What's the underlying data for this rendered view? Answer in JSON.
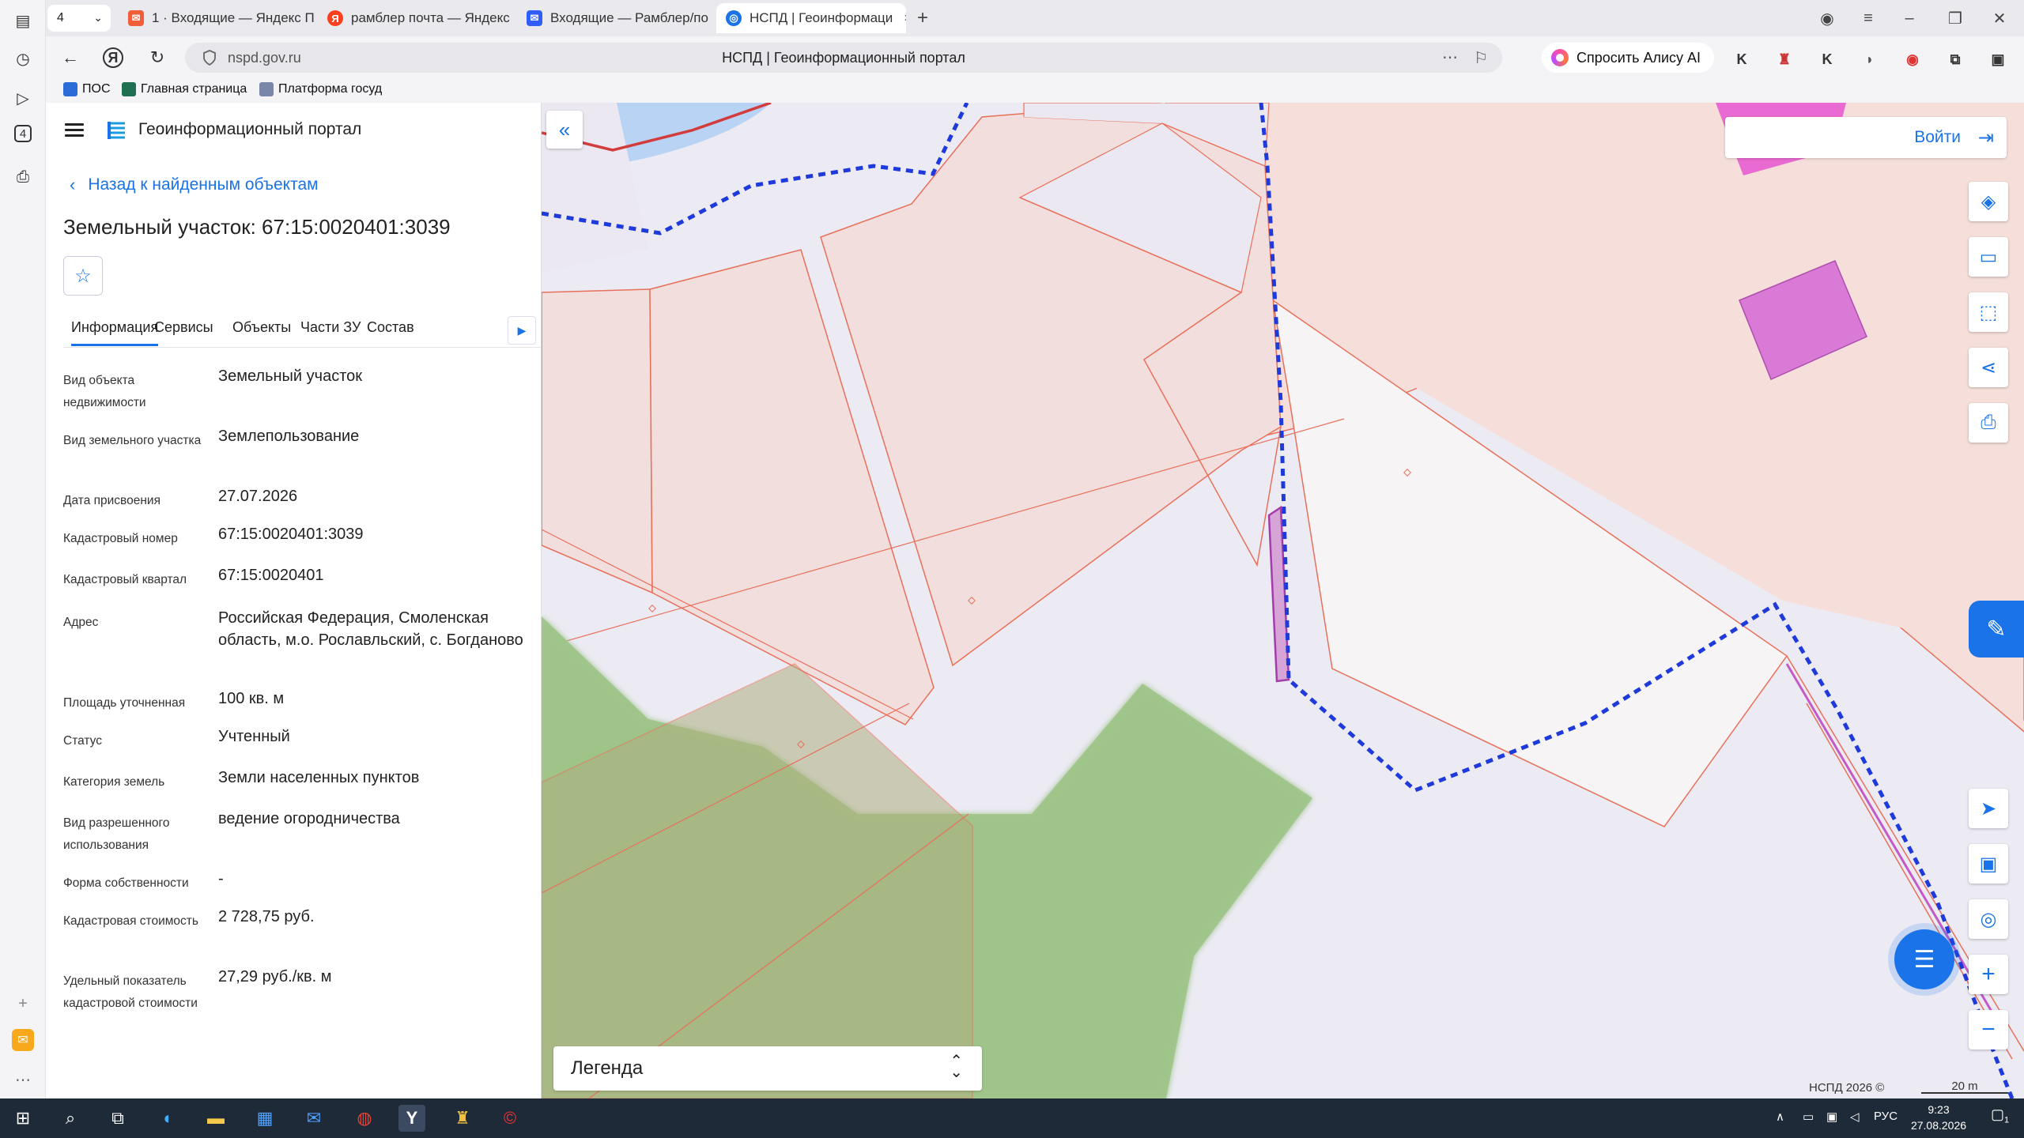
{
  "browser": {
    "tab_count": "4",
    "tabs": [
      {
        "label": "1 · Входящие — Яндекс П",
        "icon": "mail-icon",
        "color": "#f25d3a"
      },
      {
        "label": "рамблер почта — Яндекс",
        "icon": "yandex-search-icon",
        "color": "#fc3f1d"
      },
      {
        "label": "Входящие — Рамблер/по",
        "icon": "rambler-mail-icon",
        "color": "#315efb"
      },
      {
        "label": "НСПД | Геоинформаци",
        "icon": "nspd-icon",
        "color": "#1a73e8"
      }
    ],
    "domain": "nspd.gov.ru",
    "page_title": "НСПД | Геоинформационный портал",
    "alisa_label": "Спросить Алису AI",
    "bookmarks": [
      {
        "label": "ПОС"
      },
      {
        "label": "Главная страница"
      },
      {
        "label": "Платформа госуд"
      }
    ],
    "rail_badge": "4"
  },
  "panel": {
    "portal_title": "Геоинформационный портал",
    "back_label": "Назад к найденным объектам",
    "object_title": "Земельный участок: 67:15:0020401:3039",
    "tabs": [
      "Информация",
      "Сервисы",
      "Объекты",
      "Части ЗУ",
      "Состав"
    ],
    "rows": [
      {
        "label": "Вид объекта недвижимости",
        "value": "Земельный участок"
      },
      {
        "label": "Вид земельного участка",
        "value": "Землепользование"
      },
      {
        "label": "Дата присвоения",
        "value": "27.07.2026"
      },
      {
        "label": "Кадастровый номер",
        "value": "67:15:0020401:3039"
      },
      {
        "label": "Кадастровый квартал",
        "value": "67:15:0020401"
      },
      {
        "label": "Адрес",
        "value": "Российская Федерация, Смоленская область, м.о. Рославльский, с. Богданово"
      },
      {
        "label": "Площадь уточненная",
        "value": "100 кв. м"
      },
      {
        "label": "Статус",
        "value": "Учтенный"
      },
      {
        "label": "Категория земель",
        "value": "Земли населенных пунктов"
      },
      {
        "label": "Вид разрешенного использования",
        "value": "ведение огородничества"
      },
      {
        "label": "Форма собственности",
        "value": "-"
      },
      {
        "label": "Кадастровая стоимость",
        "value": "2 728,75 руб."
      },
      {
        "label": "Удельный показатель кадастровой стоимости",
        "value": "27,29 руб./кв. м"
      }
    ]
  },
  "map": {
    "login_label": "Войти",
    "legend_label": "Легенда",
    "copyright": "НСПД 2026 ©",
    "scale": "20 m",
    "colors": {
      "parcel_fill": "#f3dede",
      "parcel_stroke": "#e8705a",
      "boundary": "#1f3adb",
      "water": "#b9d3f5",
      "forest": "#9fc48a",
      "selected": "#c77ad6"
    }
  },
  "taskbar": {
    "lang": "РУС",
    "time": "9:23",
    "date": "27.08.2026",
    "notif": "1"
  }
}
